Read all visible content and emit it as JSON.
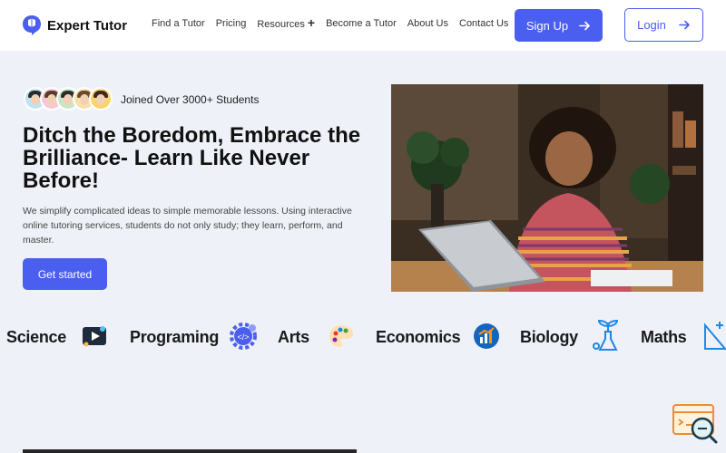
{
  "header": {
    "brand": "Expert Tutor",
    "nav": [
      {
        "label": "Find a Tutor"
      },
      {
        "label": "Pricing"
      },
      {
        "label": "Resources"
      },
      {
        "label": "Become a Tutor"
      },
      {
        "label": "About Us"
      },
      {
        "label": "Contact Us"
      }
    ],
    "signup_label": "Sign Up",
    "login_label": "Login"
  },
  "hero": {
    "joined_text": "Joined Over 3000+ Students",
    "headline": "Ditch the Boredom, Embrace the Brilliance- Learn Like Never Before!",
    "description": "We simplify complicated ideas to simple memorable lessons. Using interactive online tutoring services, students do not only study; they learn, perform, and master.",
    "cta_label": "Get started"
  },
  "subjects": [
    {
      "label": "Science",
      "icon": "video-play-icon"
    },
    {
      "label": "Programing",
      "icon": "gear-code-icon"
    },
    {
      "label": "Arts",
      "icon": "palette-icon"
    },
    {
      "label": "Economics",
      "icon": "growth-chart-icon"
    },
    {
      "label": "Biology",
      "icon": "plant-flask-icon"
    },
    {
      "label": "Maths",
      "icon": "geometry-icon"
    }
  ],
  "colors": {
    "accent": "#4a5ef0",
    "background": "#eef1f8",
    "header": "#ffffff"
  }
}
